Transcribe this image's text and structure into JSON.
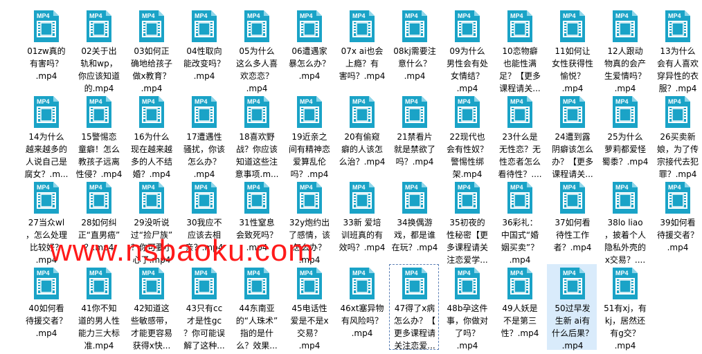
{
  "icon_badge": "MP4",
  "colors": {
    "icon_body": "#1aa3c7",
    "icon_fold": "#8fd6ea",
    "film": "#ffffff",
    "selected_bg": "#d9ebfb",
    "watermark": "#ff1a1a"
  },
  "watermark": "www.nsbaoku.com",
  "files": [
    {
      "label": "01zw真的\n有害吗？\n.mp4"
    },
    {
      "label": "02关于出\n轨和wp，\n你应该知道\n的.mp4"
    },
    {
      "label": "03如何正\n确地给孩子\n做x教育？\n.mp4"
    },
    {
      "label": "04性取向\n能改变吗？\n.mp4"
    },
    {
      "label": "05为什么\n这么多人喜\n欢恋恋？\n.mp4"
    },
    {
      "label": "06遭遇家\n暴怎么办？\n.mp4"
    },
    {
      "label": "07x ai也会\n上瘾？有\n害吗？.mp4"
    },
    {
      "label": "08kj需要注\n意什么？\n.mp4"
    },
    {
      "label": "09为什么\n男性会有处\n女情结？\n.mp4"
    },
    {
      "label": "10恋物癖\n也能性满\n足？【更多\n课程请关..."
    },
    {
      "label": "11如何让\n女性获得性\n愉悦？\n.mp4"
    },
    {
      "label": "12人跟动\n物真的会产\n生爱情吗？\n.mp4"
    },
    {
      "label": "13为什么\n会有人喜欢\n穿异性的衣\n服？.mp4"
    },
    {
      "label": "14为什么\n越来越多的\n人说自己是\n腐女？.m..."
    },
    {
      "label": "15警惕恋\n童癖！怎么\n教孩子远离\n性侵？.mp4"
    },
    {
      "label": "16为什么\n现在越来越\n多的人不结\n婚？.mp4"
    },
    {
      "label": "17遭遇性\n骚扰，你该\n怎么办？\n.mp4"
    },
    {
      "label": "18喜欢野\n战？你应该\n知道这些注\n意事项.m..."
    },
    {
      "label": "19近亲之\n间有精神恋\n爱算乱伦\n吗？.mp4"
    },
    {
      "label": "20有偷窥\n癖的人该怎\n么治？.mp4"
    },
    {
      "label": "21禁看片\n就是禁欲了\n吗？.mp4"
    },
    {
      "label": "22现代也\n会有性奴？\n警惕性绑\n架.mp4"
    },
    {
      "label": "23什么是\n无性恋？无\n性恋者怎么\n看待性？...."
    },
    {
      "label": "24遭到露\n阴癖该怎么\n办？【更多\n课程请关..."
    },
    {
      "label": "25为什么\n萝莉都爱怪\n蜀黍？.mp4"
    },
    {
      "label": "26买卖新\n娘，为了传\n宗接代去犯\n罪？.mp4"
    },
    {
      "label": "27当众wl\n，怎么处理\n比较好？\n.mp4"
    },
    {
      "label": "28如何纠\n正“直男癌”\n？.mp4"
    },
    {
      "label": "29没听说\n过“捡尸族”\n？你可要小\n心了.mp4"
    },
    {
      "label": "30我应不\n应该去相\n亲？.mp4"
    },
    {
      "label": "31性窒息\n会致死吗？\n.mp4"
    },
    {
      "label": "32y炮约出\n了感情，该\n怎么办？\n.mp4"
    },
    {
      "label": "33新 爱培\n训班真的有\n效吗？.mp4"
    },
    {
      "label": "34换偶游\n戏，都是谁\n在玩？.mp4"
    },
    {
      "label": "35初夜的\n性秘密【更\n多课程请关\n注恋爱学..."
    },
    {
      "label": "36彩礼：\n中国式“婚\n姻买卖”？\n.mp4"
    },
    {
      "label": "37如何看\n待性工作\n者？.mp4"
    },
    {
      "label": "38lo liao\n，披着个人\n隐私外壳的\n x交易？...."
    },
    {
      "label": "39如何看\n待援交者？\n.mp4"
    },
    {
      "label": "40如何看\n待援交者？\n.mp4"
    },
    {
      "label": "41你不知\n道的男人性\n能力三大标\n准.mp4"
    },
    {
      "label": "42知道这\n些敏感带，\n才能更容易\n获得x快..."
    },
    {
      "label": "43只有cc\n才是性gc\n？你可能误\n解了这种..."
    },
    {
      "label": "44东南亚\n的“人珠术”\n指的是什\n么？效果..."
    },
    {
      "label": "45电话性\n爱是不是x\n交易？\n.mp4"
    },
    {
      "label": "46xt塞异物\n有风险吗？\n.mp4"
    },
    {
      "label": "47得了x病\n怎么办？【\n更多课程请\n关注恋爱..."
    },
    {
      "label": "48b孕这件\n事，你做对\n了吗？\n.mp4"
    },
    {
      "label": "49人妖是\n不是第三\n性？.mp4"
    },
    {
      "label": "50过早发\n生新  ai有\n什么后果？\n.mp4"
    },
    {
      "label": "51有xj，有\nkj，居然还\n有g交？\n.mp4"
    }
  ]
}
